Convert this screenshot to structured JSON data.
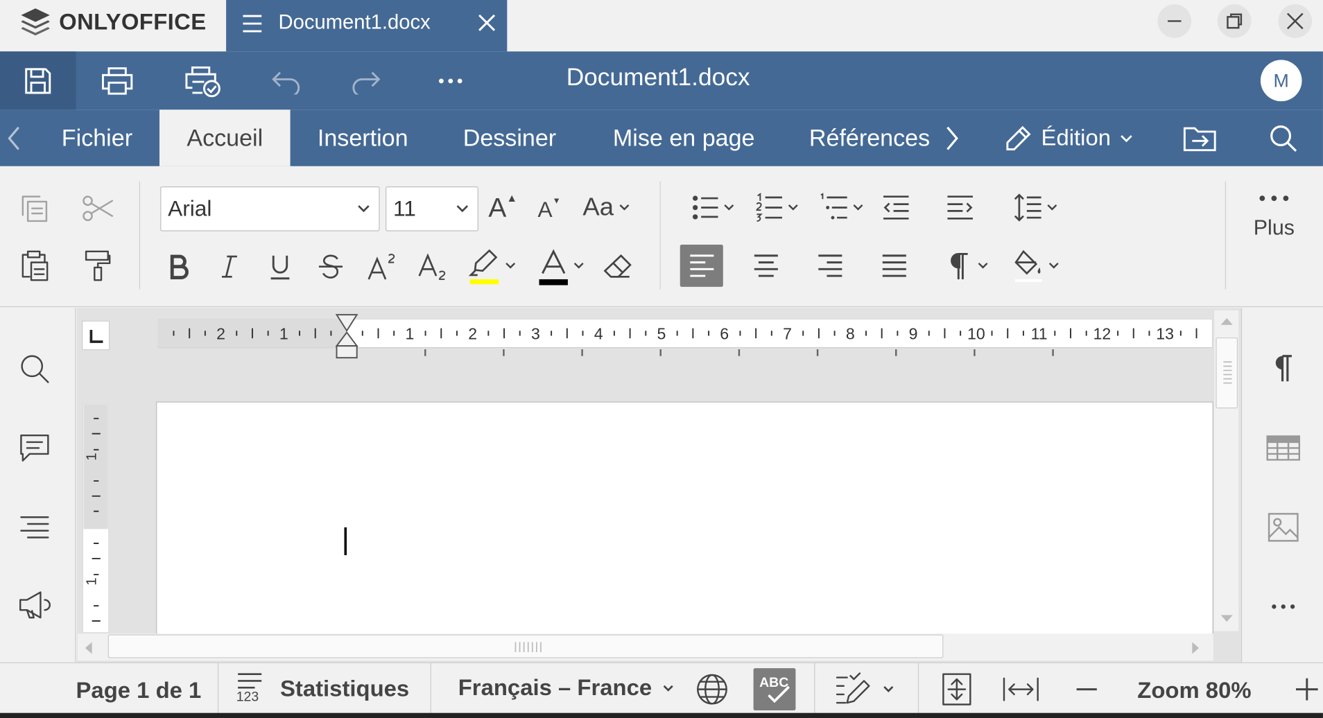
{
  "app": {
    "logo": "ONLYOFFICE"
  },
  "window": {
    "tab_title": "Document1.docx"
  },
  "header": {
    "doc_title": "Document1.docx",
    "avatar_initial": "M"
  },
  "tabs": [
    {
      "label": "Fichier"
    },
    {
      "label": "Accueil",
      "active": true
    },
    {
      "label": "Insertion"
    },
    {
      "label": "Dessiner"
    },
    {
      "label": "Mise en page"
    },
    {
      "label": "Références"
    }
  ],
  "mode": {
    "label": "Édition"
  },
  "font": {
    "family": "Arial",
    "size": "11"
  },
  "toolbar": {
    "more_label": "Plus",
    "font_size_up": "A",
    "font_size_down": "A",
    "change_case": "Aa"
  },
  "ruler": {
    "h_labels": [
      "2",
      "1",
      "1",
      "2",
      "3",
      "4",
      "5",
      "6",
      "7",
      "8",
      "9",
      "10",
      "11",
      "12",
      "13"
    ]
  },
  "status": {
    "page": "Page 1 de 1",
    "stats": "Statistiques",
    "stats_icon_text": "123",
    "language": "Français – France",
    "zoom": "Zoom 80%"
  },
  "colors": {
    "brand": "#446995",
    "highlight": "#ffff00",
    "font_color": "#000000"
  }
}
